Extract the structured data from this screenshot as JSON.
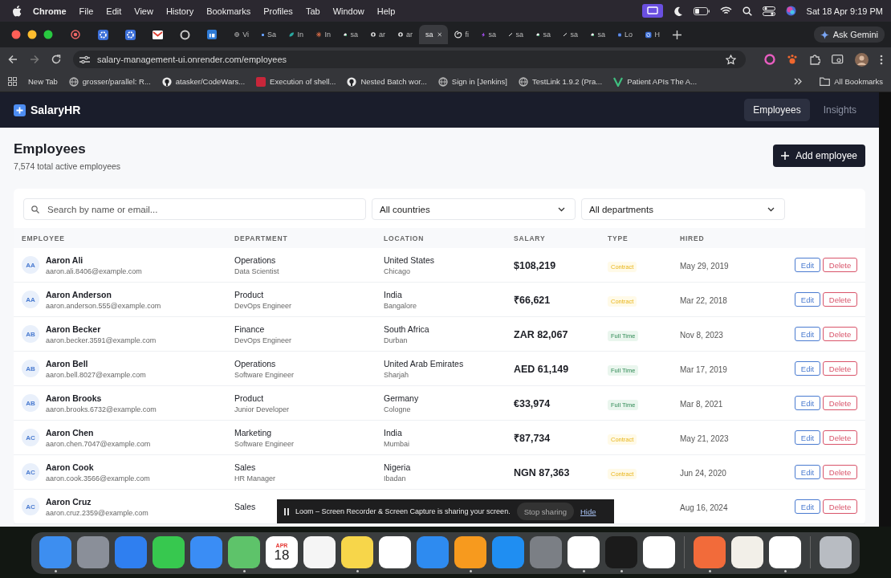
{
  "menu_bar": {
    "app": "Chrome",
    "menus": [
      "File",
      "Edit",
      "View",
      "History",
      "Bookmarks",
      "Profiles",
      "Tab",
      "Window",
      "Help"
    ],
    "clock": "Sat 18 Apr  9:19 PM"
  },
  "browser": {
    "tabs": [
      {
        "kind": "record",
        "selected": false
      },
      {
        "kind": "gear",
        "selected": false
      },
      {
        "kind": "gear",
        "selected": false
      },
      {
        "kind": "mail",
        "selected": false
      },
      {
        "kind": "ring",
        "selected": false
      },
      {
        "kind": "linkedin",
        "selected": false
      },
      {
        "kind": "globe",
        "title": "Vi",
        "selected": false
      },
      {
        "kind": "doc",
        "title": "Sa",
        "selected": false
      },
      {
        "kind": "leaf",
        "title": "In",
        "selected": false
      },
      {
        "kind": "asterisk",
        "title": "In",
        "selected": false
      },
      {
        "kind": "cloud",
        "title": "sa",
        "selected": false
      },
      {
        "kind": "github",
        "title": "ar",
        "selected": false
      },
      {
        "kind": "github",
        "title": "ar",
        "selected": false
      },
      {
        "kind": "plain",
        "title": "sa",
        "selected": true
      },
      {
        "kind": "swirl",
        "title": "fi",
        "selected": false
      },
      {
        "kind": "bolt",
        "title": "sa",
        "selected": false
      },
      {
        "kind": "link",
        "title": "sa",
        "selected": false
      },
      {
        "kind": "cloud",
        "title": "sa",
        "selected": false
      },
      {
        "kind": "link",
        "title": "sa",
        "selected": false
      },
      {
        "kind": "cloud",
        "title": "sa",
        "selected": false
      },
      {
        "kind": "gear",
        "title": "Lo",
        "selected": false
      },
      {
        "kind": "gear",
        "title": "H",
        "selected": false
      }
    ],
    "gemini": "Ask Gemini",
    "url": "salary-management-ui.onrender.com/employees",
    "bookmarks": [
      {
        "kind": "plain",
        "label": "New Tab"
      },
      {
        "kind": "globe",
        "label": "grosser/parallel: R..."
      },
      {
        "kind": "github",
        "label": "atasker/CodeWars..."
      },
      {
        "kind": "square",
        "label": "Execution of shell..."
      },
      {
        "kind": "github",
        "label": "Nested Batch wor..."
      },
      {
        "kind": "globe",
        "label": "Sign in [Jenkins]"
      },
      {
        "kind": "globe",
        "label": "TestLink 1.9.2 (Pra..."
      },
      {
        "kind": "v",
        "label": "Patient APIs The A..."
      }
    ],
    "all_bookmarks": "All Bookmarks"
  },
  "app": {
    "brand": "SalaryHR",
    "nav": [
      {
        "label": "Employees",
        "selected": true
      },
      {
        "label": "Insights",
        "selected": false
      }
    ],
    "title": "Employees",
    "subtitle": "7,574 total active employees",
    "add_button": "Add employee",
    "search": {
      "placeholder": "Search by name or email..."
    },
    "filters": [
      {
        "value": "All countries"
      },
      {
        "value": "All departments"
      }
    ],
    "columns": [
      "EMPLOYEE",
      "DEPARTMENT",
      "LOCATION",
      "SALARY",
      "TYPE",
      "HIRED"
    ],
    "rows": [
      {
        "initials": "AA",
        "name": "Aaron Ali",
        "email": "aaron.ali.8406@example.com",
        "department": "Operations",
        "role": "Data Scientist",
        "country": "United States",
        "city": "Chicago",
        "salary": "$108,219",
        "type": {
          "label": "Contract",
          "kind": "contract"
        },
        "hired": "May 29, 2019",
        "edit": "Edit",
        "delete": "Delete"
      },
      {
        "initials": "AA",
        "name": "Aaron Anderson",
        "email": "aaron.anderson.555@example.com",
        "department": "Product",
        "role": "DevOps Engineer",
        "country": "India",
        "city": "Bangalore",
        "salary": "₹66,621",
        "type": {
          "label": "Contract",
          "kind": "contract"
        },
        "hired": "Mar 22, 2018",
        "edit": "Edit",
        "delete": "Delete"
      },
      {
        "initials": "AB",
        "name": "Aaron Becker",
        "email": "aaron.becker.3591@example.com",
        "department": "Finance",
        "role": "DevOps Engineer",
        "country": "South Africa",
        "city": "Durban",
        "salary": "ZAR 82,067",
        "type": {
          "label": "Full Time",
          "kind": "full_time"
        },
        "hired": "Nov 8, 2023",
        "edit": "Edit",
        "delete": "Delete"
      },
      {
        "initials": "AB",
        "name": "Aaron Bell",
        "email": "aaron.bell.8027@example.com",
        "department": "Operations",
        "role": "Software Engineer",
        "country": "United Arab Emirates",
        "city": "Sharjah",
        "salary": "AED 61,149",
        "type": {
          "label": "Full Time",
          "kind": "full_time"
        },
        "hired": "Mar 17, 2019",
        "edit": "Edit",
        "delete": "Delete"
      },
      {
        "initials": "AB",
        "name": "Aaron Brooks",
        "email": "aaron.brooks.6732@example.com",
        "department": "Product",
        "role": "Junior Developer",
        "country": "Germany",
        "city": "Cologne",
        "salary": "€33,974",
        "type": {
          "label": "Full Time",
          "kind": "full_time"
        },
        "hired": "Mar 8, 2021",
        "edit": "Edit",
        "delete": "Delete"
      },
      {
        "initials": "AC",
        "name": "Aaron Chen",
        "email": "aaron.chen.7047@example.com",
        "department": "Marketing",
        "role": "Software Engineer",
        "country": "India",
        "city": "Mumbai",
        "salary": "₹87,734",
        "type": {
          "label": "Contract",
          "kind": "contract"
        },
        "hired": "May 21, 2023",
        "edit": "Edit",
        "delete": "Delete"
      },
      {
        "initials": "AC",
        "name": "Aaron Cook",
        "email": "aaron.cook.3566@example.com",
        "department": "Sales",
        "role": "HR Manager",
        "country": "Nigeria",
        "city": "Ibadan",
        "salary": "NGN 87,363",
        "type": {
          "label": "Contract",
          "kind": "contract"
        },
        "hired": "Jun 24, 2020",
        "edit": "Edit",
        "delete": "Delete"
      },
      {
        "initials": "AC",
        "name": "Aaron Cruz",
        "email": "aaron.cruz.2359@example.com",
        "department": "Sales",
        "hired": "Aug 16, 2024",
        "edit": "Edit",
        "delete": "Delete"
      }
    ]
  },
  "loom": {
    "message": "Loom – Screen Recorder & Screen Capture is sharing your screen.",
    "stop": "Stop sharing",
    "hide": "Hide"
  },
  "dock": [
    {
      "kind": "finder",
      "running": true
    },
    {
      "kind": "launchpad",
      "running": false
    },
    {
      "kind": "safari",
      "running": false
    },
    {
      "kind": "messages",
      "running": false
    },
    {
      "kind": "mail",
      "running": false
    },
    {
      "kind": "maps",
      "running": true
    },
    {
      "kind": "calendar",
      "month": "APR",
      "day": "18",
      "running": false
    },
    {
      "kind": "reminders",
      "running": false
    },
    {
      "kind": "notes",
      "running": true
    },
    {
      "kind": "freeform",
      "running": false
    },
    {
      "kind": "keynote",
      "running": false
    },
    {
      "kind": "pages",
      "running": true
    },
    {
      "kind": "appstore",
      "running": false
    },
    {
      "kind": "settings",
      "running": false
    },
    {
      "kind": "chrome",
      "running": true
    },
    {
      "kind": "terminal",
      "running": true
    },
    {
      "kind": "vscode",
      "running": false
    },
    {
      "kind": "divider"
    },
    {
      "kind": "postman",
      "running": true
    },
    {
      "kind": "beaver",
      "running": false
    },
    {
      "kind": "vscode",
      "running": true
    },
    {
      "kind": "divider"
    },
    {
      "kind": "trash",
      "running": false
    }
  ]
}
